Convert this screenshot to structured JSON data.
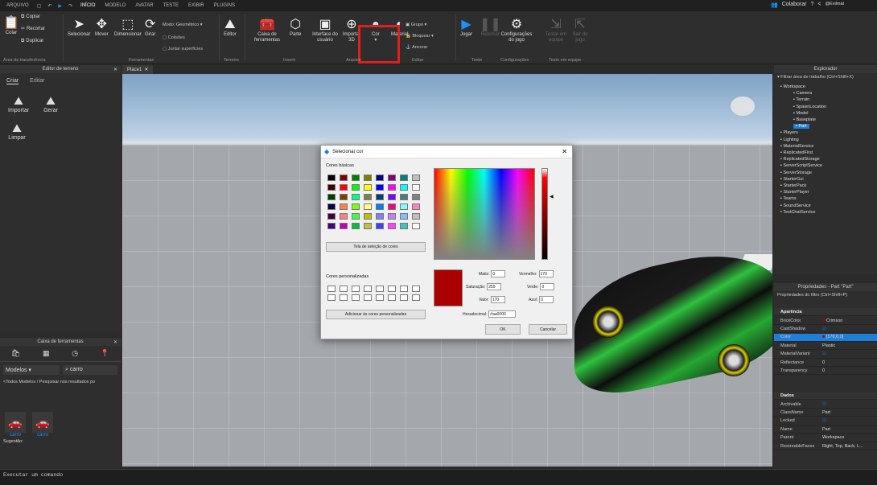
{
  "menubar": {
    "items": [
      "ARQUIVO",
      "INÍCIO",
      "MODELO",
      "AVATAR",
      "TESTE",
      "EXIBIR",
      "PLUGINS"
    ],
    "collaborate": "Colaborar",
    "user": "@Evilmat"
  },
  "ribbon": {
    "copy": "Copiar",
    "cut": "Recortar",
    "duplicate": "Duplicar",
    "paste": "Colar",
    "select": "Selecionar",
    "move": "Mover",
    "scale": "Dimensionar",
    "rotate": "Girar",
    "mode_label": "Modo:",
    "mode_value": "Geométrico",
    "collisions": "Colisões",
    "join": "Juntar superfícies",
    "editor": "Editor",
    "toolbox": "Caixa de ferramentas",
    "part": "Parte",
    "ui": "Interface do usuário",
    "import3d": "Importar 3D",
    "color": "Cor",
    "material": "Material",
    "group": "Grupo",
    "lock": "Bloquear",
    "anchor": "Ancorar",
    "play": "Jogar",
    "resume": "Retomar",
    "game_settings": "Configurações do jogo",
    "team_test": "Testar em equipe",
    "leave": "Sair do jogo",
    "groups": [
      "Área de transferência",
      "Ferramentas",
      "Terreno",
      "Inserir",
      "Arquivo",
      "Editar",
      "Teste",
      "Configurações",
      "Teste em equipe"
    ]
  },
  "terrain": {
    "title": "Editor de terreno",
    "tabs": [
      "Criar",
      "Editar"
    ],
    "import": "Importar",
    "generate": "Gerar",
    "clear": "Limpar"
  },
  "doc_tab": "Place1",
  "toolbox": {
    "title": "Caixa de ferramentas",
    "category": "Modelos",
    "search": "carro",
    "breadcrumb": "<Todos Modelos / Pesquisar nos resultados po",
    "results": [
      "carro",
      "carro"
    ],
    "suggest": "Sugestão:"
  },
  "command": "Executar um comando",
  "dialog": {
    "title": "Selecionar cor",
    "basic": "Cores básicas",
    "screen_pick": "Tela de seleção de cores",
    "custom": "Cores personalizadas",
    "add_custom": "Adicionar às cores personalizadas",
    "hue_label": "Matiz:",
    "hue": "0",
    "sat_label": "Saturação:",
    "sat": "255",
    "val_label": "Valor:",
    "val": "170",
    "red_label": "Vermelho:",
    "red": "170",
    "green_label": "Verde:",
    "green": "0",
    "blue_label": "Azul:",
    "blue": "0",
    "hex_label": "Hexadecimal:",
    "hex": "#aa0000",
    "ok": "OK",
    "cancel": "Cancelar",
    "selected_color": "#aa0000",
    "basic_colors": [
      "#000000",
      "#800000",
      "#008000",
      "#808000",
      "#000080",
      "#800080",
      "#008080",
      "#c0c0c0",
      "#400000",
      "#ff0000",
      "#00ff00",
      "#ffff00",
      "#0000ff",
      "#ff00ff",
      "#00ffff",
      "#ffffff",
      "#004000",
      "#804000",
      "#00ff80",
      "#808040",
      "#004080",
      "#8000ff",
      "#408080",
      "#808080",
      "#000040",
      "#ff8040",
      "#80ff00",
      "#ffff80",
      "#0080ff",
      "#ff0080",
      "#80ffff",
      "#ff80c0",
      "#400040",
      "#ff8080",
      "#40ff40",
      "#c0c000",
      "#8080ff",
      "#c080ff",
      "#80c0ff",
      "#c0c0c0",
      "#400080",
      "#c000c0",
      "#00c040",
      "#c0c040",
      "#4040ff",
      "#ff40ff",
      "#40c0c0",
      "#ffffff"
    ]
  },
  "explorer": {
    "title": "Explorador",
    "filter": "Filtrar área de trabalho (Ctrl+Shift+X)",
    "items": [
      "Workspace",
      "Camera",
      "Terrain",
      "SpawnLocation",
      "Model",
      "Baseplate",
      "Part",
      "Players",
      "Lighting",
      "MaterialService",
      "ReplicatedFirst",
      "ReplicatedStorage",
      "ServerScriptService",
      "ServerStorage",
      "StarterGui",
      "StarterPack",
      "StarterPlayer",
      "Teams",
      "SoundService",
      "TextChatService"
    ]
  },
  "properties": {
    "title": "Propriedades - Part \"Part\"",
    "filter": "Propriedades do filtro (Ctrl+Shift+P)",
    "section_appearance": "Aparência",
    "section_data": "Dados",
    "rows": [
      [
        "BrickColor",
        "Crimson"
      ],
      [
        "CastShadow",
        ""
      ],
      [
        "Color",
        "[170,0,0]"
      ],
      [
        "Material",
        "Plastic"
      ],
      [
        "MaterialVariant",
        ""
      ],
      [
        "Reflectance",
        "0"
      ],
      [
        "Transparency",
        "0"
      ]
    ],
    "data_rows": [
      [
        "Archivable",
        ""
      ],
      [
        "ClassName",
        "Part"
      ],
      [
        "Locked",
        ""
      ],
      [
        "Name",
        "Part"
      ],
      [
        "Parent",
        "Workspace"
      ],
      [
        "ResizeableFaces",
        "Right, Top, Back, L..."
      ]
    ]
  },
  "colors": {
    "accent": "#1e7fd8",
    "highlight": "#e02020",
    "selected": "#aa0000"
  }
}
